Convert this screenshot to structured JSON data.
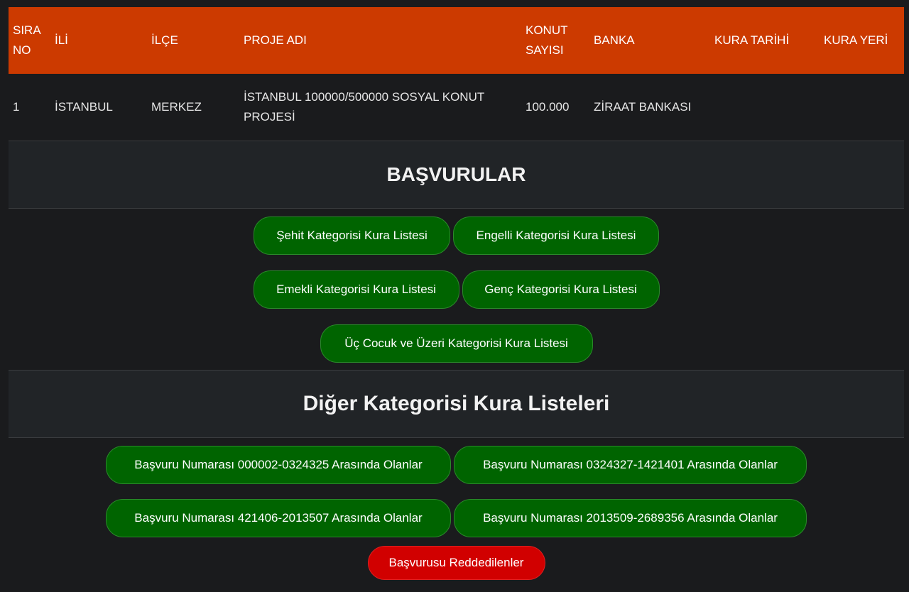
{
  "table": {
    "headers": {
      "sira_no": "SIRA NO",
      "il": "İLİ",
      "ilce": "İLÇE",
      "proje_adi": "PROJE ADI",
      "konut_sayisi": "KONUT SAYISI",
      "banka": "BANKA",
      "kura_tarihi": "KURA TARİHİ",
      "kura_yeri": "KURA YERİ"
    },
    "row": {
      "sira_no": "1",
      "il": "İSTANBUL",
      "ilce": "MERKEZ",
      "proje_adi": "İSTANBUL  100000/500000 SOSYAL KONUT PROJESİ",
      "konut_sayisi": "100.000",
      "banka": "ZİRAAT BANKASI",
      "kura_tarihi": "",
      "kura_yeri": ""
    }
  },
  "basvurular": {
    "title": "BAŞVURULAR",
    "buttons": [
      "Şehit Kategorisi Kura Listesi",
      "Engelli Kategorisi Kura Listesi",
      "Emekli Kategorisi Kura Listesi",
      "Genç Kategorisi Kura Listesi",
      "Üç Cocuk ve Üzeri Kategorisi Kura Listesi"
    ]
  },
  "diger": {
    "title": "Diğer Kategorisi Kura Listeleri",
    "buttons": [
      "Başvuru Numarası 000002-0324325 Arasında Olanlar",
      "Başvuru Numarası 0324327-1421401 Arasında Olanlar",
      "Başvuru Numarası 421406-2013507 Arasında Olanlar",
      "Başvuru Numarası 2013509-2689356 Arasında Olanlar"
    ],
    "rejected_button": "Başvurusu Reddedilenler"
  },
  "colors": {
    "header_bg": "#cc3a00",
    "green_button": "#006400",
    "red_button": "#d10000",
    "page_bg": "#1a1b1d"
  }
}
